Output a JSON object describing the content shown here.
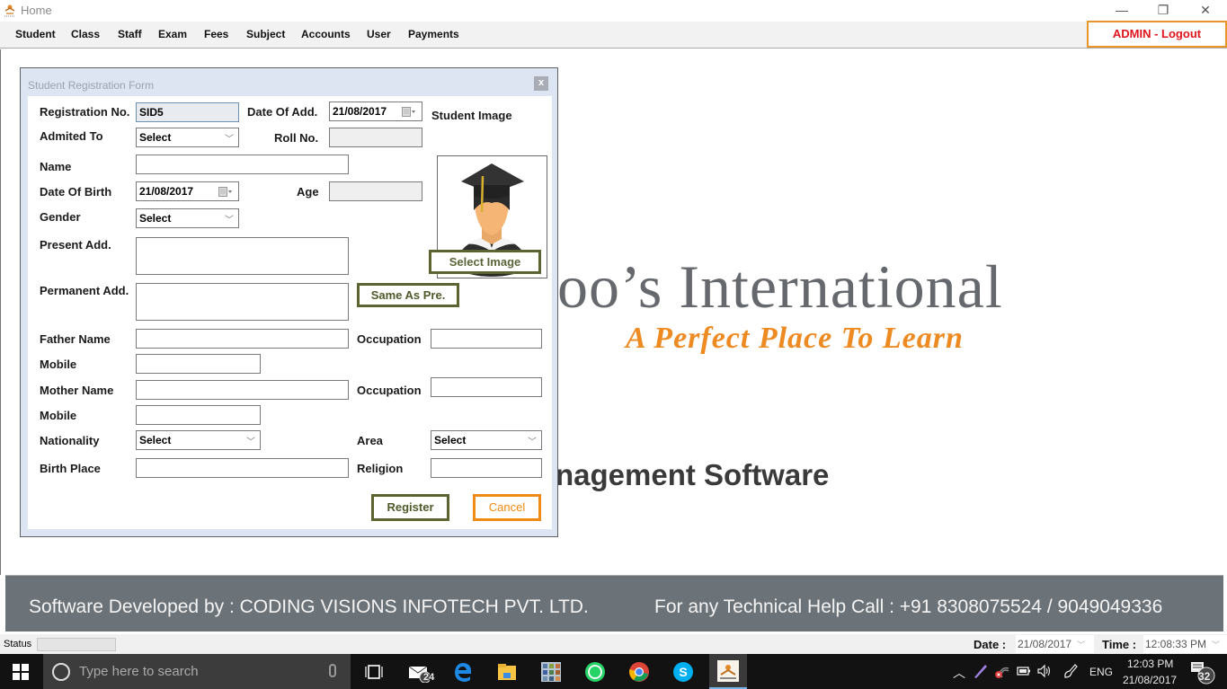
{
  "window": {
    "title": "Home",
    "controls": {
      "minimize": "—",
      "restore": "❐",
      "close": "✕"
    }
  },
  "menu": {
    "items": [
      "Student",
      "Class",
      "Staff",
      "Exam",
      "Fees",
      "Subject",
      "Accounts",
      "User",
      "Payments"
    ],
    "logout_label": "ADMIN - Logout"
  },
  "background": {
    "school_name_partial": "oo’s International",
    "tagline": "A Perfect Place To Learn",
    "software_partial": "nagement Software"
  },
  "footer": {
    "developer_text": "Software Developed by : CODING VISIONS INFOTECH PVT. LTD.",
    "help_text": "For any Technical Help Call : +91 8308075524 / 9049049336"
  },
  "statusbar": {
    "status_label": "Status",
    "status_value": "",
    "date_label": "Date :",
    "date_value": "21/08/2017",
    "time_label": "Time :",
    "time_value": "12:08:33 PM"
  },
  "dialog": {
    "title": "Student Registration Form",
    "close_label": "x",
    "fields": {
      "registration_no": {
        "label": "Registration No.",
        "value": "SID5"
      },
      "date_of_add": {
        "label": "Date Of Add.",
        "value": "21/08/2017"
      },
      "admited_to": {
        "label": "Admited To",
        "value": "Select"
      },
      "roll_no": {
        "label": "Roll No.",
        "value": ""
      },
      "name": {
        "label": "Name",
        "value": ""
      },
      "date_of_birth": {
        "label": "Date Of Birth",
        "value": "21/08/2017"
      },
      "age": {
        "label": "Age",
        "value": ""
      },
      "gender": {
        "label": "Gender",
        "value": "Select"
      },
      "present_add": {
        "label": "Present Add.",
        "value": ""
      },
      "permanent_add": {
        "label": "Permanent Add.",
        "value": ""
      },
      "father_name": {
        "label": "Father Name",
        "value": ""
      },
      "father_occupation": {
        "label": "Occupation",
        "value": ""
      },
      "father_mobile": {
        "label": "Mobile",
        "value": ""
      },
      "mother_name": {
        "label": "Mother Name",
        "value": ""
      },
      "mother_occupation": {
        "label": "Occupation",
        "value": ""
      },
      "mother_mobile": {
        "label": "Mobile",
        "value": ""
      },
      "nationality": {
        "label": "Nationality",
        "value": "Select"
      },
      "area": {
        "label": "Area",
        "value": "Select"
      },
      "birth_place": {
        "label": "Birth Place",
        "value": ""
      },
      "religion": {
        "label": "Religion",
        "value": ""
      }
    },
    "student_image_label": "Student Image",
    "select_image_label": "Select Image",
    "same_as_pre_label": "Same As Pre.",
    "register_label": "Register",
    "cancel_label": "Cancel"
  },
  "taskbar": {
    "search_placeholder": "Type here to search",
    "mail_badge": "24",
    "language": "ENG",
    "clock_time": "12:03 PM",
    "clock_date": "21/08/2017",
    "notification_count": "32"
  },
  "colors": {
    "accent_olive": "#5a6430",
    "accent_orange": "#f08a12",
    "logout_red": "#e0141c",
    "footer_gray": "#6c7378"
  }
}
